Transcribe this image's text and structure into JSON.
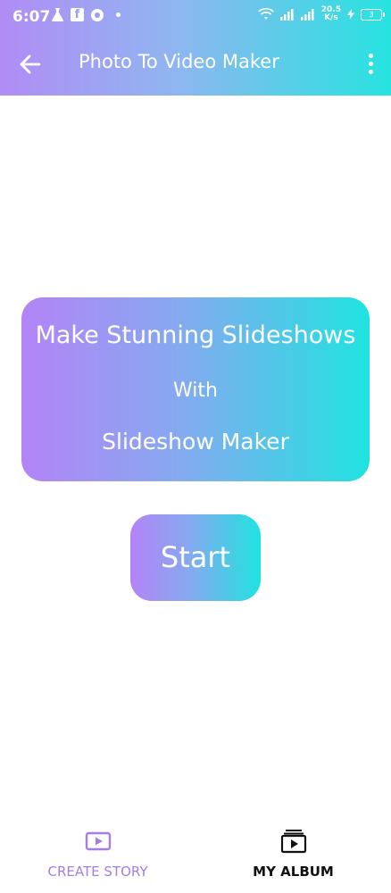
{
  "status_bar": {
    "time": "6:07",
    "fb_glyph": "f",
    "net_speed_top": "20.5",
    "net_speed_bottom": "K/s",
    "battery": "3",
    "icons": [
      "flask-icon",
      "facebook-icon",
      "messenger-icon",
      "dot-icon",
      "wifi-icon",
      "signal-icon",
      "signal-icon",
      "charging-icon",
      "battery-icon"
    ]
  },
  "toolbar": {
    "title": "Photo To Video Maker",
    "back_icon": "arrow-left-icon",
    "more_icon": "more-vertical-icon"
  },
  "hero": {
    "line1": "Make Stunning Slideshows",
    "line2": "With",
    "line3": "Slideshow Maker"
  },
  "start_button": {
    "label": "Start"
  },
  "bottom_nav": {
    "items": [
      {
        "label": "CREATE STORY",
        "icon": "play-rectangle-icon",
        "active": true
      },
      {
        "label": "MY ALBUM",
        "icon": "album-stack-icon",
        "active": false
      }
    ]
  },
  "colors": {
    "gradient_start": "#b384f6",
    "gradient_end": "#1fe3e0",
    "active_nav": "#a57de3",
    "inactive_nav": "#111111"
  }
}
